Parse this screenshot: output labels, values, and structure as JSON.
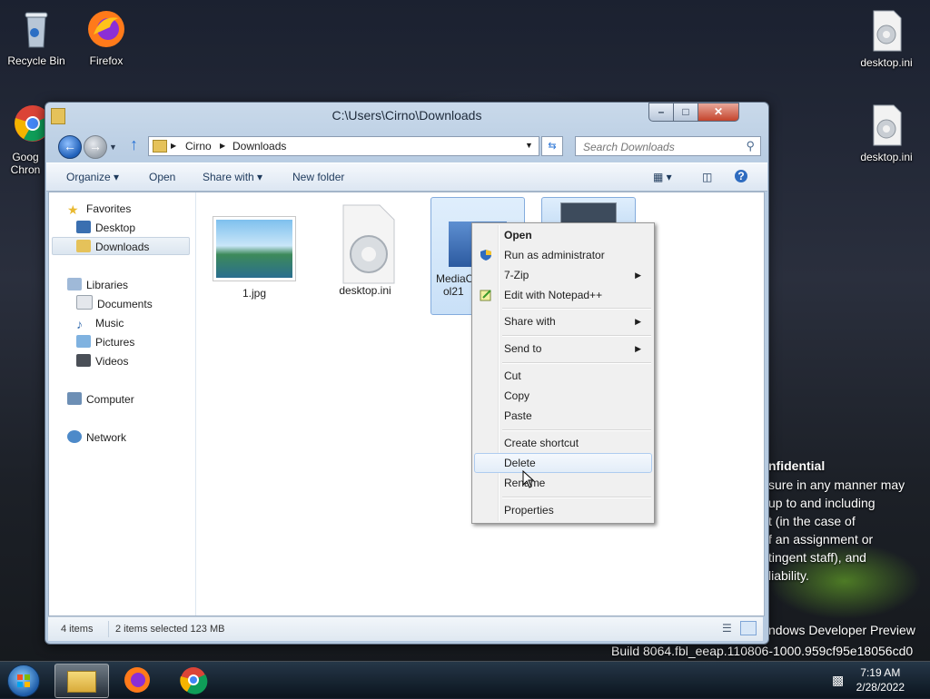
{
  "desktop": {
    "icons": [
      {
        "label": "Recycle Bin",
        "icon": "recycle-bin-icon"
      },
      {
        "label": "Firefox",
        "icon": "firefox-icon"
      },
      {
        "label": "Goog Chron",
        "icon": "chrome-icon"
      },
      {
        "label": "desktop.ini",
        "icon": "settings-file-icon"
      },
      {
        "label": "desktop.ini",
        "icon": "settings-file-icon"
      }
    ],
    "watermark": {
      "lines": [
        "nfidential",
        "sure in any manner may",
        "up to and including",
        "t (in the case of",
        "f an assignment or",
        "tingent staff), and",
        "liability."
      ],
      "edition": "ndows Developer Preview",
      "build": "Build 8064.fbl_eeap.110806-1000.959cf95e18056cd0"
    }
  },
  "window": {
    "title": "C:\\Users\\Cirno\\Downloads",
    "controls": {
      "minimize": "–",
      "maximize": "□",
      "close": "✕"
    },
    "address": {
      "crumbs": [
        "Cirno",
        "Downloads"
      ]
    },
    "search": {
      "placeholder": "Search Downloads"
    },
    "toolbar": {
      "organize": "Organize",
      "open": "Open",
      "share_with": "Share with",
      "new_folder": "New folder"
    },
    "sidebar": {
      "favorites": "Favorites",
      "favorites_items": [
        "Desktop",
        "Downloads"
      ],
      "libraries": "Libraries",
      "library_items": [
        "Documents",
        "Music",
        "Pictures",
        "Videos"
      ],
      "computer": "Computer",
      "network": "Network"
    },
    "files": [
      {
        "name": "1.jpg",
        "selected": false
      },
      {
        "name": "desktop.ini",
        "selected": false
      },
      {
        "name": "MediaC",
        "name2": "ol21",
        "selected": true
      },
      {
        "name": "",
        "selected": true
      }
    ],
    "status": {
      "item_count": "4 items",
      "selection": "2 items selected  123 MB"
    }
  },
  "context_menu": {
    "items": [
      {
        "label": "Open",
        "bold": true
      },
      {
        "label": "Run as administrator"
      },
      {
        "label": "7-Zip",
        "submenu": true
      },
      {
        "label": "Edit with Notepad++"
      },
      {
        "label": "Share with",
        "submenu": true
      },
      {
        "label": "Send to",
        "submenu": true
      },
      {
        "label": "Cut"
      },
      {
        "label": "Copy"
      },
      {
        "label": "Paste"
      },
      {
        "label": "Create shortcut"
      },
      {
        "label": "Delete",
        "highlighted": true
      },
      {
        "label": "Rename"
      },
      {
        "label": "Properties"
      }
    ]
  },
  "taskbar": {
    "time": "7:19 AM",
    "date": "2/28/2022"
  }
}
